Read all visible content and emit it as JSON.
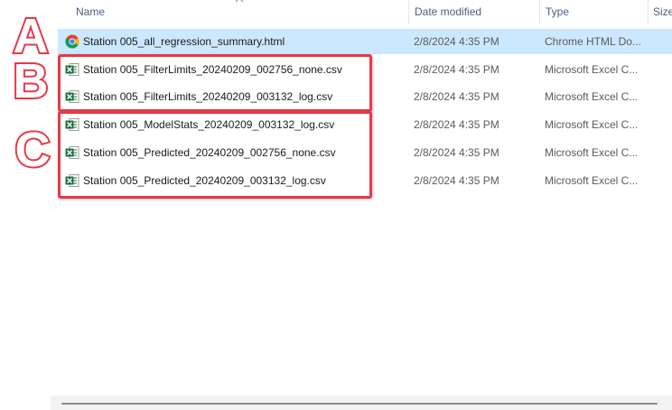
{
  "columns": {
    "name": "Name",
    "date_modified": "Date modified",
    "type": "Type",
    "size": "Size"
  },
  "files": [
    {
      "name": "Station 005_all_regression_summary.html",
      "date": "2/8/2024 4:35 PM",
      "type": "Chrome HTML Do...",
      "icon": "chrome-icon",
      "selected": true
    },
    {
      "name": "Station 005_FilterLimits_20240209_002756_none.csv",
      "date": "2/8/2024 4:35 PM",
      "type": "Microsoft Excel C...",
      "icon": "excel-csv-icon",
      "selected": false
    },
    {
      "name": "Station 005_FilterLimits_20240209_003132_log.csv",
      "date": "2/8/2024 4:35 PM",
      "type": "Microsoft Excel C...",
      "icon": "excel-csv-icon",
      "selected": false
    },
    {
      "name": "Station 005_ModelStats_20240209_003132_log.csv",
      "date": "2/8/2024 4:35 PM",
      "type": "Microsoft Excel C...",
      "icon": "excel-csv-icon",
      "selected": false
    },
    {
      "name": "Station 005_Predicted_20240209_002756_none.csv",
      "date": "2/8/2024 4:35 PM",
      "type": "Microsoft Excel C...",
      "icon": "excel-csv-icon",
      "selected": false
    },
    {
      "name": "Station 005_Predicted_20240209_003132_log.csv",
      "date": "2/8/2024 4:35 PM",
      "type": "Microsoft Excel C...",
      "icon": "excel-csv-icon",
      "selected": false
    }
  ],
  "annotations": {
    "labels": [
      "A",
      "B",
      "C"
    ],
    "box_color": "#e63946",
    "letter_fill": "#ffffff",
    "letter_outline": "#e63946"
  },
  "colors": {
    "selection": "#cce8ff",
    "header_text": "#4c607a",
    "excel_green": "#1d6f42"
  }
}
